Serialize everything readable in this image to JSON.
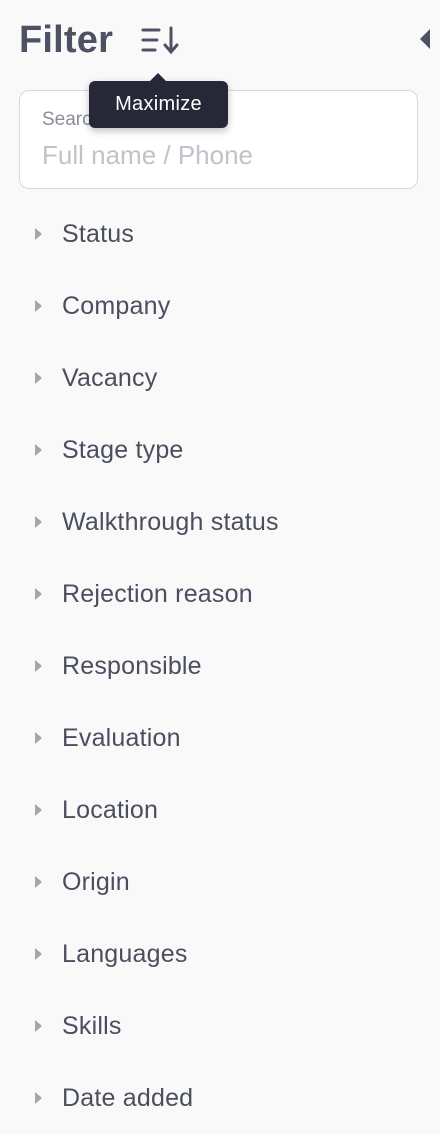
{
  "panel": {
    "title": "Filter",
    "sort_icon": "sort-descending-icon",
    "collapse_icon": "caret-left-icon",
    "tooltip": "Maximize"
  },
  "search": {
    "label": "Search",
    "placeholder": "Full name / Phone",
    "value": ""
  },
  "filters": [
    {
      "label": "Status"
    },
    {
      "label": "Company"
    },
    {
      "label": "Vacancy"
    },
    {
      "label": "Stage type"
    },
    {
      "label": "Walkthrough status"
    },
    {
      "label": "Rejection reason"
    },
    {
      "label": "Responsible"
    },
    {
      "label": "Evaluation"
    },
    {
      "label": "Location"
    },
    {
      "label": "Origin"
    },
    {
      "label": "Languages"
    },
    {
      "label": "Skills"
    },
    {
      "label": "Date added"
    }
  ],
  "colors": {
    "background": "#f9f9fa",
    "text": "#4b4e5e",
    "tooltip_bg": "#262838",
    "caret": "#a4a6ae"
  }
}
